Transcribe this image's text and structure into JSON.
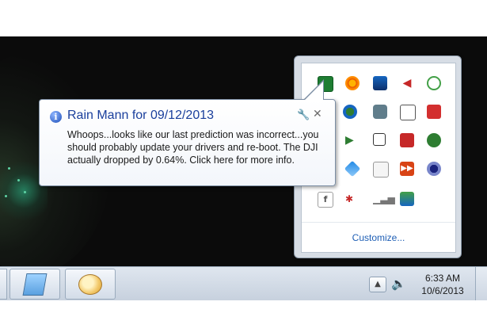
{
  "notification": {
    "title": "Rain Mann for 09/12/2013",
    "body": "Whoops...looks like our last prediction was incorrect...you should probably update your drivers and re-boot.  The DJI actually dropped by 0.64%.  Click here for more info."
  },
  "tray_overflow": {
    "customize_label": "Customize...",
    "icons": [
      [
        "green-app-icon",
        "gear-icon",
        "network-monitor-icon",
        "speaker-icon",
        "sync-icon"
      ],
      [
        "firefox-icon",
        "security-shield-icon",
        "clipboard-icon",
        "pdf-icon"
      ],
      [
        "media-player-icon",
        "windows-flags-icon",
        "adobe-icon",
        "spotify-icon"
      ],
      [
        "dropbox-icon",
        "blocked-app-icon",
        "play-forward-icon",
        "eye-app-icon"
      ],
      [
        "facebook-icon",
        "antenna-icon",
        "signal-bars-icon",
        "network-share-icon"
      ]
    ]
  },
  "taskbar": {
    "show_hidden_glyph": "▲",
    "volume_glyph": "🔈",
    "time": "6:33 AM",
    "date": "10/6/2013"
  }
}
